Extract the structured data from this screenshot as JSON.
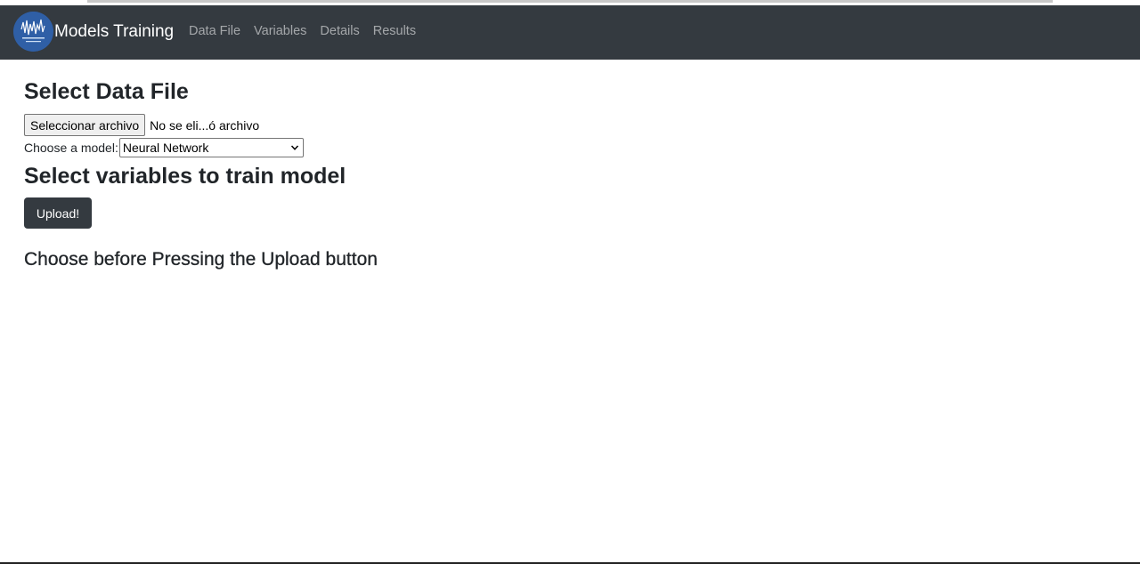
{
  "navbar": {
    "brand": "Models Training",
    "links": [
      "Data File",
      "Variables",
      "Details",
      "Results"
    ],
    "background": "#343a40",
    "logo_color": "#2f5fa6"
  },
  "data_file": {
    "title": "Select Data File",
    "file_button_label": "Seleccionar archivo",
    "file_status": "No se eli...ó archivo"
  },
  "model": {
    "label": "Choose a model:",
    "selected": "Neural Network"
  },
  "variables": {
    "title": "Select variables to train model"
  },
  "upload": {
    "button_label": "Upload!"
  },
  "hint": "Choose before Pressing the Upload button"
}
